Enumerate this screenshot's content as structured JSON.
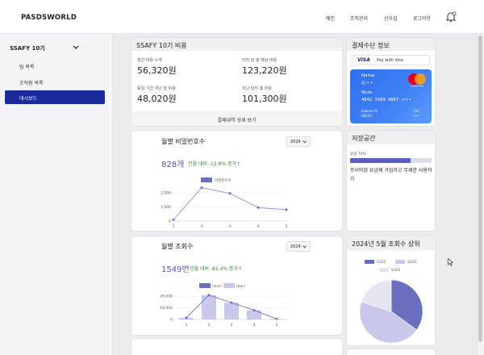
{
  "brand": "PASDSWORLD",
  "nav": [
    "메인",
    "조직관리",
    "신우섭",
    "로그아웃"
  ],
  "sidebar": {
    "group": "SSAFY 10기",
    "items": [
      "팀 목록",
      "조직원 목록"
    ],
    "active": "대시보드"
  },
  "cost": {
    "title": "SSAFY 10기 비용",
    "stats": [
      {
        "label": "월간 비용 누계",
        "value": "56,320원"
      },
      {
        "label": "이번 달 총 예상 비용",
        "value": "123,220원"
      },
      {
        "label": "동일 기간 지난 달 비용",
        "value": "48,020원"
      },
      {
        "label": "지난 달의 총 비용",
        "value": "101,300원"
      }
    ],
    "detail": "결제내역 상세 보기"
  },
  "payment": {
    "title": "결제수단 정보",
    "visa": "VISA",
    "pay_with": "Pay with Visa",
    "name_label": "Name",
    "name_value": "이 * *",
    "num_label": "Num.",
    "num_value": "4642  3489  9867  ••••",
    "exp_label": "Expires At",
    "exp_value": "02/25",
    "cvc_label": "CVC",
    "cvc_value": "•••",
    "brand": "mastercard"
  },
  "storage": {
    "title": "저장공간",
    "usage_label": "용량 74%",
    "usage_pct": 74,
    "message": "프리미엄 요금제 가입하고 무제한 사용하기"
  },
  "pw_chart": {
    "title": "월별 비밀번호수",
    "year": "2024",
    "big": "828개",
    "change": "전월 대비 -12.8% 증가↑"
  },
  "view_chart": {
    "title": "월별 조회수",
    "year": "2024",
    "big": "1549번",
    "change": "전월 대비 -81.4% 증가↑"
  },
  "top_card": {
    "title": "2024년 5월 조회수 상위"
  },
  "chart_data": [
    {
      "type": "line",
      "title": "월별 비밀번호수",
      "x": [
        1,
        2,
        3,
        4,
        5
      ],
      "series": [
        {
          "name": "비밀번호수",
          "values": [
            100,
            2350,
            1950,
            950,
            800
          ]
        }
      ],
      "yticks": [
        "0",
        "1,000",
        "2,000"
      ],
      "ylim": [
        0,
        2500
      ]
    },
    {
      "type": "bar",
      "title": "월별 조회수",
      "categories": [
        "1",
        "2",
        "3",
        "4",
        "5"
      ],
      "series": [
        {
          "name": "(line)",
          "values": [
            1500,
            21000,
            14500,
            8000,
            500
          ]
        },
        {
          "name": "(bar)",
          "values": [
            1500,
            21000,
            14500,
            8000,
            500
          ]
        }
      ],
      "yticks": [
        "0",
        "10,000",
        "20,000"
      ],
      "ylim": [
        0,
        25000
      ]
    },
    {
      "type": "pie",
      "title": "2024년 5월 조회수 상위",
      "series": [
        {
          "name": "S101",
          "value": 35,
          "color": "#6b6fbf"
        },
        {
          "name": "S102",
          "value": 45,
          "color": "#c8c9ea"
        },
        {
          "name": "S103",
          "value": 20,
          "color": "#e4e4f3"
        }
      ]
    }
  ]
}
